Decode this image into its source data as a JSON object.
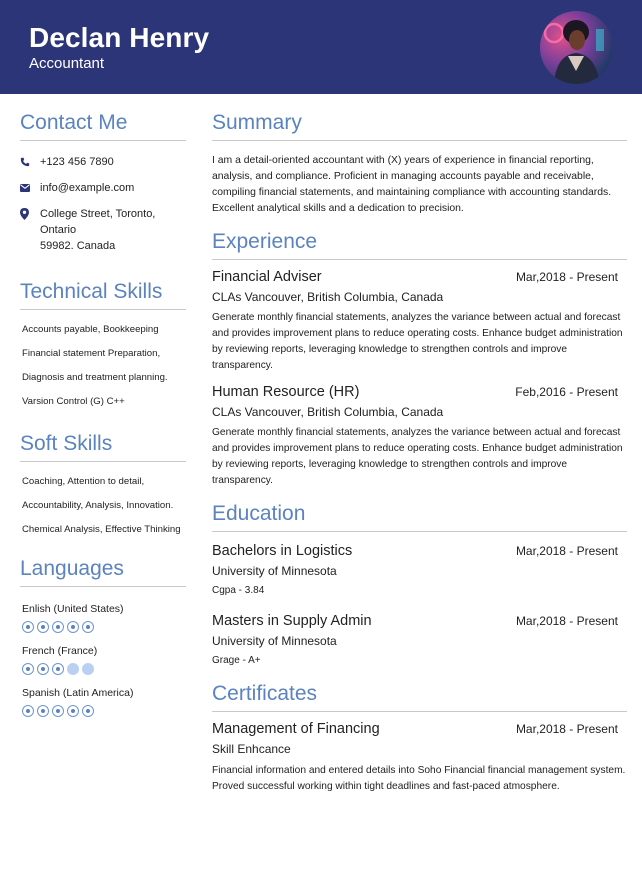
{
  "header": {
    "name": "Declan Henry",
    "role": "Accountant"
  },
  "colors": {
    "header_bg": "#2d3579",
    "accent": "#5b83bf",
    "dot_empty": "#b9d0f3"
  },
  "contact": {
    "title": "Contact Me",
    "phone": "+123 456 7890",
    "email": "info@example.com",
    "address_line1": "College Street, Toronto, Ontario",
    "address_line2": "59982. Canada",
    "icons": [
      "phone-icon",
      "email-icon",
      "location-pin-icon"
    ]
  },
  "technical_skills": {
    "title": "Technical Skills",
    "items": [
      "Accounts payable, Bookkeeping",
      "Financial statement Preparation,",
      "Diagnosis and treatment planning.",
      "Varsion Control (G) C++"
    ]
  },
  "soft_skills": {
    "title": "Soft Skills",
    "items": [
      "Coaching, Attention to detail,",
      "Accountability, Analysis, Innovation.",
      "Chemical Analysis, Effective Thinking"
    ]
  },
  "languages": {
    "title": "Languages",
    "items": [
      {
        "name": "Enlish (United States)",
        "level": 5,
        "max": 5
      },
      {
        "name": "French (France)",
        "level": 3,
        "max": 5
      },
      {
        "name": "Spanish (Latin America)",
        "level": 5,
        "max": 5
      }
    ]
  },
  "summary": {
    "title": "Summary",
    "text": "I am a detail-oriented accountant with (X) years of experience in financial reporting, analysis, and compliance. Proficient in managing accounts payable and receivable, compiling financial statements, and maintaining compliance with accounting standards. Excellent analytical skills and a dedication to precision."
  },
  "experience": {
    "title": "Experience",
    "items": [
      {
        "title": "Financial Adviser",
        "date": "Mar,2018 - Present",
        "company": "CLAs Vancouver, British Columbia, Canada",
        "desc": "Generate monthly financial statements, analyzes the variance between actual and forecast and provides improvement plans to reduce operating costs. Enhance budget administration by reviewing reports, leveraging knowledge to strengthen controls and improve transparency."
      },
      {
        "title": "Human Resource (HR)",
        "date": "Feb,2016 - Present",
        "company": "CLAs Vancouver, British Columbia, Canada",
        "desc": "Generate monthly financial statements, analyzes the variance between actual and forecast and provides improvement plans to reduce operating costs. Enhance budget administration by reviewing reports, leveraging knowledge to strengthen controls and improve transparency."
      }
    ]
  },
  "education": {
    "title": "Education",
    "items": [
      {
        "degree": "Bachelors in Logistics",
        "date": "Mar,2018 - Present",
        "school": "University of Minnesota",
        "grade": "Cgpa - 3.84"
      },
      {
        "degree": "Masters in Supply Admin",
        "date": "Mar,2018 - Present",
        "school": "University of Minnesota",
        "grade": "Grage - A+"
      }
    ]
  },
  "certificates": {
    "title": "Certificates",
    "items": [
      {
        "title": "Management of Financing",
        "date": "Mar,2018 - Present",
        "issuer": "Skill Enhcance",
        "desc": "Financial information and entered details into Soho Financial financial management system. Proved successful working within tight deadlines and fast-paced atmosphere."
      }
    ]
  }
}
